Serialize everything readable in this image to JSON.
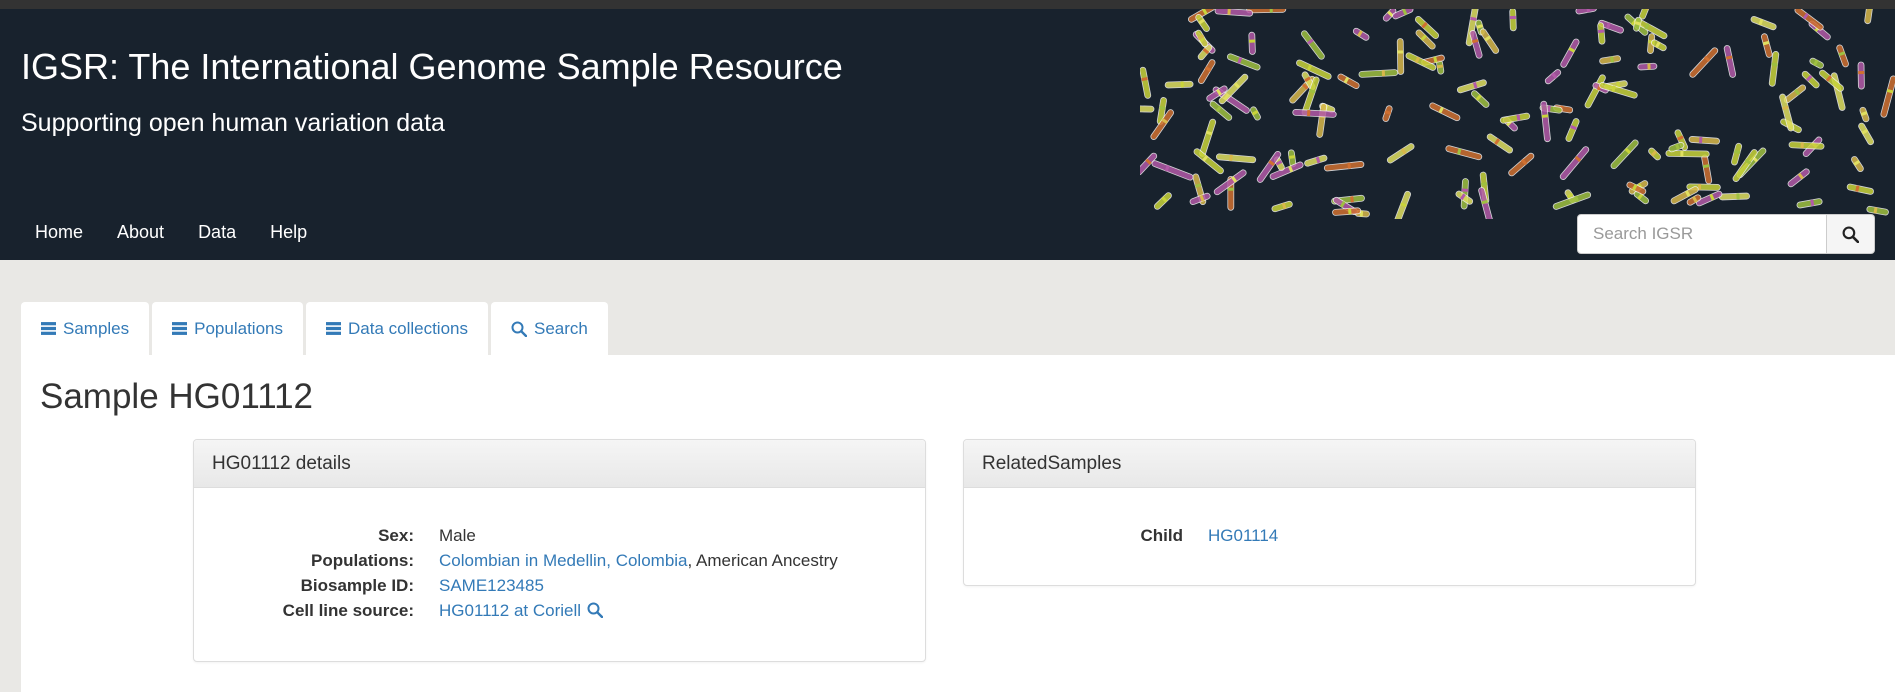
{
  "header": {
    "title": "IGSR: The International Genome Sample Resource",
    "subtitle": "Supporting open human variation data"
  },
  "nav": {
    "items": [
      "Home",
      "About",
      "Data",
      "Help"
    ]
  },
  "search": {
    "placeholder": "Search IGSR",
    "button_icon": "search-icon"
  },
  "tabs": [
    {
      "label": "Samples",
      "icon": "list-icon"
    },
    {
      "label": "Populations",
      "icon": "list-icon"
    },
    {
      "label": "Data collections",
      "icon": "list-icon"
    },
    {
      "label": "Search",
      "icon": "search-icon"
    }
  ],
  "page": {
    "title": "Sample HG01112"
  },
  "details_panel": {
    "heading": "HG01112 details",
    "sex_label": "Sex:",
    "sex_value": "Male",
    "populations_label": "Populations:",
    "population_link": "Colombian in Medellin, Colombia",
    "population_suffix": ", American Ancestry",
    "biosample_label": "Biosample ID:",
    "biosample_value": "SAME123485",
    "cell_line_label": "Cell line source:",
    "cell_line_value": "HG01112 at Coriell"
  },
  "related_panel": {
    "heading": "RelatedSamples",
    "child_label": "Child",
    "child_value": "HG01114"
  },
  "colors": {
    "header_bg": "#18222d",
    "link": "#337ab7",
    "page_bg": "#e9e8e5"
  }
}
